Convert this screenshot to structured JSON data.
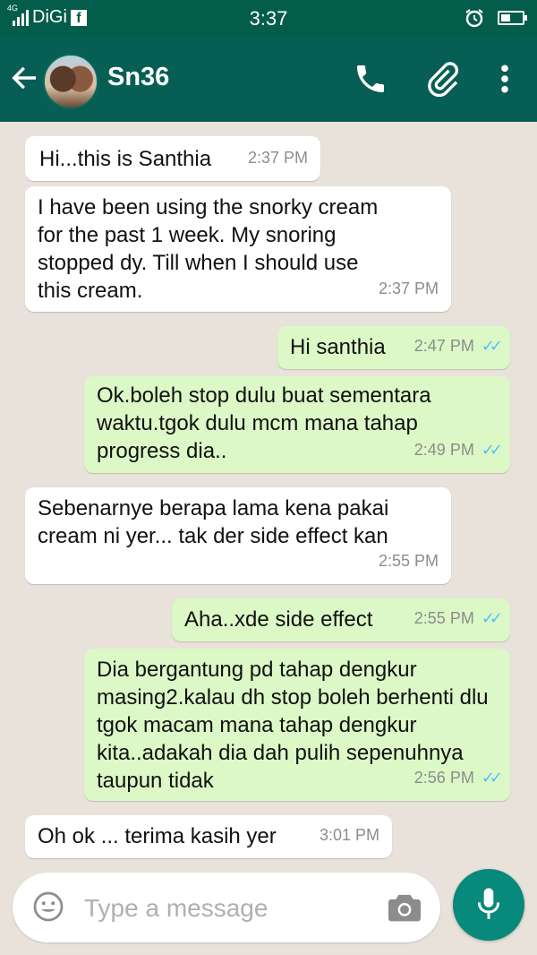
{
  "status_bar": {
    "network": "4G",
    "carrier": "DiGi",
    "fb_icon": "f",
    "time": "3:37",
    "icons": [
      "alarm-icon",
      "battery-icon"
    ]
  },
  "header": {
    "contact_name": "Sn36",
    "icons": [
      "back-arrow-icon",
      "avatar",
      "phone-icon",
      "paperclip-icon",
      "more-vertical-icon"
    ]
  },
  "messages": [
    {
      "dir": "in",
      "text": "Hi...this is Santhia",
      "time": "2:37 PM"
    },
    {
      "dir": "in",
      "text": "I have been using the snorky cream for the past 1 week. My snoring stopped dy. Till when I should use this cream.",
      "time": "2:37 PM"
    },
    {
      "dir": "out",
      "text": "Hi santhia",
      "time": "2:47 PM",
      "status": "read"
    },
    {
      "dir": "out",
      "text": "Ok.boleh stop dulu buat sementara waktu.tgok dulu mcm mana tahap progress dia..",
      "time": "2:49 PM",
      "status": "read"
    },
    {
      "dir": "in",
      "text": "Sebenarnye berapa lama kena pakai cream ni yer... tak der side effect kan",
      "time": "2:55 PM"
    },
    {
      "dir": "out",
      "text": "Aha..xde side effect",
      "time": "2:55 PM",
      "status": "read"
    },
    {
      "dir": "out",
      "text": "Dia bergantung pd tahap dengkur masing2.kalau dh stop boleh berhenti dlu tgok macam mana tahap dengkur kita..adakah dia dah pulih sepenuhnya taupun tidak",
      "time": "2:56 PM",
      "status": "read"
    },
    {
      "dir": "in",
      "text": "Oh ok ... terima kasih yer",
      "time": "3:01 PM"
    }
  ],
  "input": {
    "placeholder": "Type a message",
    "icons": [
      "emoji-icon",
      "camera-icon",
      "mic-icon"
    ]
  },
  "colors": {
    "header": "#075e54",
    "status_bar": "#035d4a",
    "outgoing_bubble": "#dcf8c6",
    "incoming_bubble": "#ffffff",
    "chat_bg": "#e8e2da",
    "read_ticks": "#4fc3f7",
    "mic_button": "#07897b"
  }
}
